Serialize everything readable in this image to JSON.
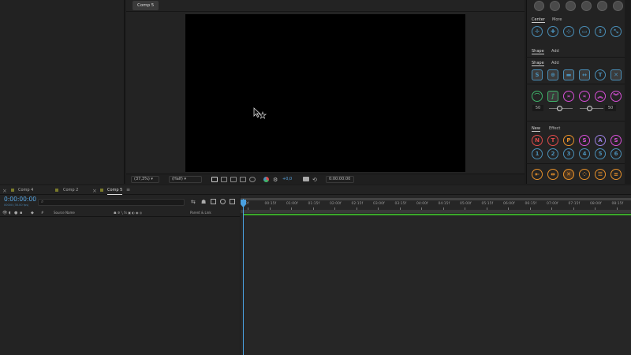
{
  "viewer": {
    "tab": "Comp 5",
    "zoom": "(37,3%)",
    "resolution": "(Half)",
    "exposure": "+0,0",
    "timecode": "0:00:00:00"
  },
  "right_panel": {
    "section1": {
      "tabs": [
        "Center",
        "More"
      ]
    },
    "section2": {
      "tabs": [
        "Shape",
        "Add"
      ]
    },
    "section3": {
      "tabs": [
        "Shape",
        "Add"
      ]
    },
    "sliders": {
      "left_value": "50",
      "right_value": "50"
    },
    "section4": {
      "tabs": [
        "New",
        "Effect"
      ],
      "letters": [
        "N",
        "T",
        "P",
        "S",
        "A",
        "S"
      ],
      "numbers": [
        "1",
        "2",
        "3",
        "4",
        "5",
        "6"
      ]
    },
    "colors": {
      "blue": "#4a8fb8",
      "green": "#3fb36a",
      "pink": "#d64fd6",
      "red": "#e04a4a",
      "orange": "#e8912a",
      "purple": "#9a7fe0",
      "yellow": "#e0c84a"
    }
  },
  "timeline": {
    "tabs": [
      "Comp 4",
      "Comp 2",
      "Comp 5"
    ],
    "timecode": "0:00:00:00",
    "fps": "00000 (30.00 fps)",
    "columns": {
      "source_name": "Source Name",
      "hash": "#",
      "parent": "Parent & Link"
    },
    "ruler": [
      "00f",
      "00:15f",
      "01:00f",
      "01:15f",
      "02:00f",
      "02:15f",
      "03:00f",
      "03:15f",
      "04:00f",
      "04:15f",
      "05:00f",
      "05:15f",
      "06:00f",
      "06:15f",
      "07:00f",
      "07:15f",
      "08:00f",
      "08:15f"
    ]
  }
}
